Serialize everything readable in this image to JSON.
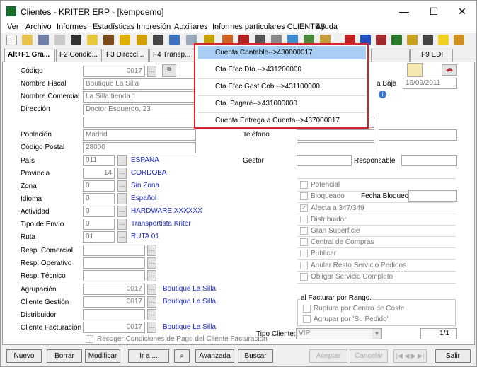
{
  "window": {
    "title": "Clientes - KRITER ERP - [kempdemo]",
    "minimize": "—",
    "maximize": "☐",
    "close": "✕"
  },
  "menu": [
    "Ver",
    "Archivo",
    "Informes",
    "Estadísticas",
    "Impresión",
    "Auxiliares",
    "Informes particulares CLIENTES",
    "Ayuda"
  ],
  "tabs": [
    "Alt+F1 Gra...",
    "F2 Condic...",
    "F3 Direcci...",
    "F4 Transp...",
    "F9 EDI"
  ],
  "popup": {
    "items": [
      "Cuenta Contable-->430000017",
      "Cta.Efec.Dto.-->431200000",
      "Cta.Efec.Gest.Cob.-->431100000",
      "Cta. Pagaré-->431000000",
      "Cuenta Entrega a Cuenta-->437000017"
    ]
  },
  "form": {
    "codigo": {
      "label": "Código",
      "value": "0017"
    },
    "nombre_fiscal": {
      "label": "Nombre Fiscal",
      "value": "Boutique La Silla"
    },
    "nombre_comercial": {
      "label": "Nombre Comercial",
      "value": "La Silla tienda 1"
    },
    "direccion": {
      "label": "Dirección",
      "value": "Doctor Esquerdo, 23"
    },
    "poblacion": {
      "label": "Población",
      "value": "Madrid"
    },
    "codigo_postal": {
      "label": "Código Postal",
      "value": "28000"
    },
    "pais": {
      "label": "País",
      "code": "011",
      "name": "ESPAÑA"
    },
    "provincia": {
      "label": "Provincia",
      "code": "14",
      "name": "CORDOBA"
    },
    "zona": {
      "label": "Zona",
      "code": "0",
      "name": "Sin Zona"
    },
    "idioma": {
      "label": "Idioma",
      "code": "0",
      "name": "Español"
    },
    "actividad": {
      "label": "Actividad",
      "code": "0",
      "name": "HARDWARE XXXXXX"
    },
    "tipo_envio": {
      "label": "Tipo de Envío",
      "code": "0",
      "name": "Transportista Kriter"
    },
    "ruta": {
      "label": "Ruta",
      "code": "01",
      "name": "RUTA 01"
    },
    "resp_comercial": {
      "label": "Resp. Comercial"
    },
    "resp_operativo": {
      "label": "Resp. Operativo"
    },
    "resp_tecnico": {
      "label": "Resp. Técnico"
    },
    "agrupacion": {
      "label": "Agrupación",
      "code": "0017",
      "name": "Boutique La Silla"
    },
    "cliente_gestion": {
      "label": "Cliente Gestión",
      "code": "0017",
      "name": "Boutique La Silla"
    },
    "distribuidor": {
      "label": "Distribuidor"
    },
    "cliente_facturacion": {
      "label": "Cliente Facturación",
      "code": "0017",
      "name": "Boutique La Silla"
    },
    "recoger_condiciones": "Recoger Condiciones de Pago del Cliente Facturación",
    "fecha_baja_label": "a Baja",
    "fecha_baja": "16/09/2011",
    "telefono_label": "Teléfono",
    "gestor_label": "Gestor",
    "responsable_label": "Responsable",
    "tipo_cliente_label": "Tipo Cliente:",
    "tipo_cliente": "VIP",
    "paginacion": "1/1"
  },
  "checks": {
    "potencial": "Potencial",
    "bloqueado": "Bloqueado",
    "fecha_bloqueo": "Fecha Bloqueo",
    "afecta": "Afecta a 347/349",
    "distribuidor": "Distribuidor",
    "gran_superficie": "Gran Superficie",
    "central_compras": "Central de Compras",
    "publicar": "Publicar",
    "anular_resto": "Anular Resto Servicio Pedidos",
    "obligar_servicio": "Obligar Servicio Completo",
    "al_facturar": "al Facturar por Rango.",
    "ruptura": "Ruptura por Centro de Coste",
    "agrupar": "Agrupar por 'Su Pedido'"
  },
  "buttons": {
    "nuevo": "Nuevo",
    "borrar": "Borrar",
    "modificar": "Modificar",
    "ir_a": "Ir a ...",
    "avanzada": "Avanzada",
    "buscar": "Buscar",
    "aceptar": "Aceptar",
    "cancelar": "Cancelar",
    "salir": "Salir"
  },
  "colors": {
    "link_blue": "#1a27c9",
    "popup_border": "#d6262a",
    "popup_selected": "#a8cef3"
  }
}
